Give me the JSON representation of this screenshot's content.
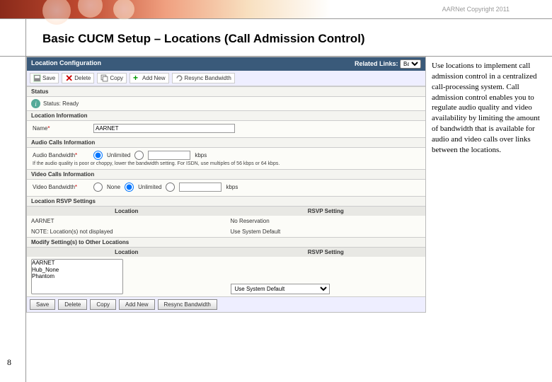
{
  "copyright": "AARNet Copyright 2011",
  "slide_title": "Basic CUCM Setup – Locations (Call Admission Control)",
  "cu": {
    "titlebar": "Location Configuration",
    "related_label": "Related Links:",
    "related_value": "Bac",
    "toolbar": {
      "save": "Save",
      "delete": "Delete",
      "copy": "Copy",
      "addnew": "Add New",
      "resync": "Resync Bandwidth"
    },
    "status": {
      "heading": "Status",
      "text": "Status: Ready"
    },
    "loc_info": {
      "heading": "Location Information",
      "name_label": "Name",
      "name_value": "AARNET"
    },
    "audio": {
      "heading": "Audio Calls Information",
      "bw_label": "Audio Bandwidth",
      "unlimited": "Unlimited",
      "unit": "kbps",
      "note": "If the audio quality is poor or choppy, lower the bandwidth setting. For ISDN, use multiples of 56 kbps or 64 kbps."
    },
    "video": {
      "heading": "Video Calls Information",
      "bw_label": "Video Bandwidth",
      "none": "None",
      "unlimited": "Unlimited",
      "unit": "kbps"
    },
    "rsvp": {
      "heading": "Location RSVP Settings",
      "col_loc": "Location",
      "col_set": "RSVP Setting",
      "row_loc": "AARNET",
      "row_set": "No Reservation",
      "note_label": "NOTE: Location(s) not displayed",
      "note_set": "Use System Default"
    },
    "modify": {
      "heading": "Modify Setting(s) to Other Locations",
      "col_loc": "Location",
      "col_set": "RSVP Setting",
      "options": [
        "AARNET",
        "Hub_None",
        "Phantom"
      ],
      "dd_value": "Use System Default"
    }
  },
  "side_text": "Use locations to implement call admission control in a centralized call-processing system. Call admission control enables you to regulate audio quality and video availability by limiting the amount of bandwidth that is available for audio and video calls over links between the locations.",
  "page_number": "8",
  "bottom": {
    "save": "Save",
    "delete": "Delete",
    "copy": "Copy",
    "addnew": "Add New",
    "resync": "Resync Bandwidth"
  }
}
